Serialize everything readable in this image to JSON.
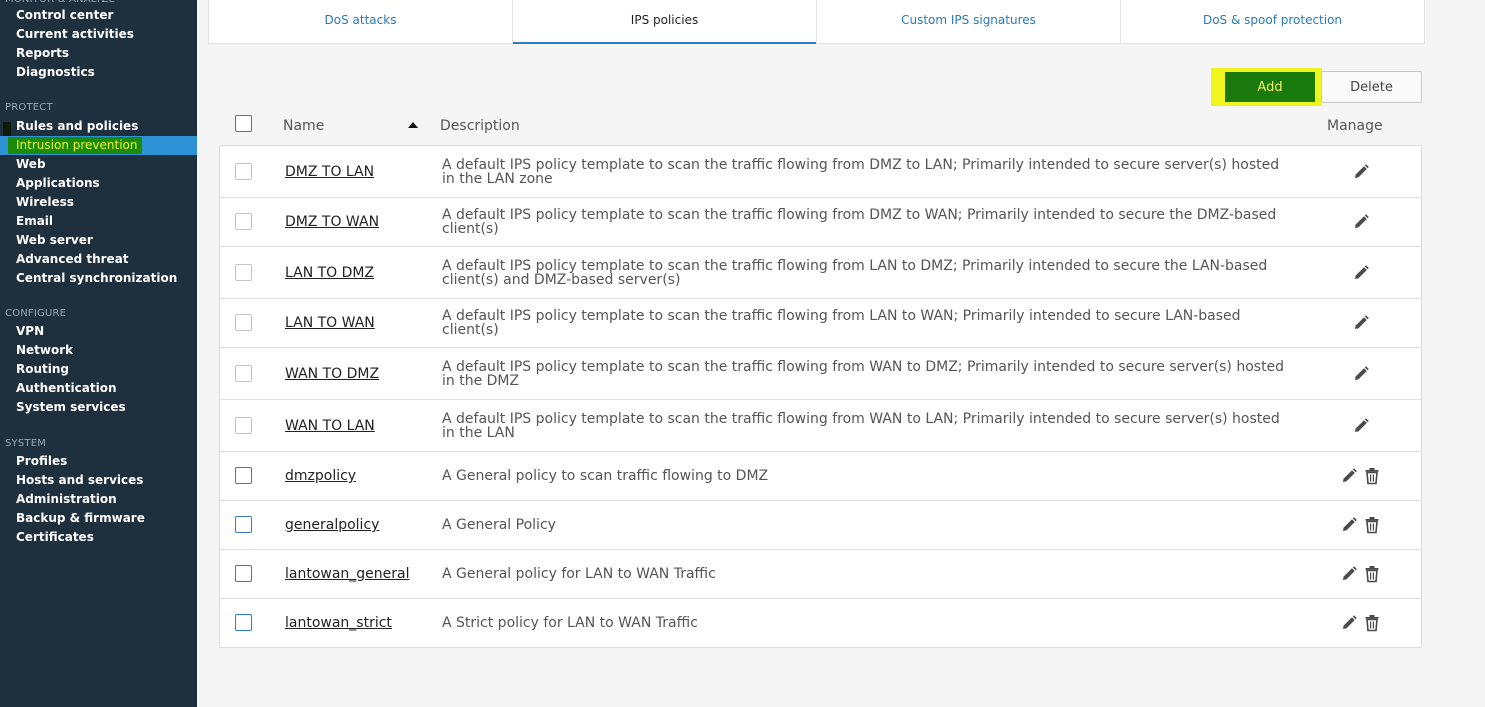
{
  "sidebar": {
    "sections": [
      {
        "header": "MONITOR & ANALYZE",
        "items": [
          "Control center",
          "Current activities",
          "Reports",
          "Diagnostics"
        ]
      },
      {
        "header": "PROTECT",
        "items": [
          "Rules and policies",
          "Intrusion prevention",
          "Web",
          "Applications",
          "Wireless",
          "Email",
          "Web server",
          "Advanced threat",
          "Central synchronization"
        ]
      },
      {
        "header": "CONFIGURE",
        "items": [
          "VPN",
          "Network",
          "Routing",
          "Authentication",
          "System services"
        ]
      },
      {
        "header": "SYSTEM",
        "items": [
          "Profiles",
          "Hosts and services",
          "Administration",
          "Backup & firmware",
          "Certificates"
        ]
      }
    ],
    "active_item": "Intrusion prevention"
  },
  "tabs": [
    {
      "label": "DoS attacks",
      "active": false
    },
    {
      "label": "IPS policies",
      "active": true
    },
    {
      "label": "Custom IPS signatures",
      "active": false
    },
    {
      "label": "DoS & spoof protection",
      "active": false
    }
  ],
  "toolbar": {
    "add_label": "Add",
    "delete_label": "Delete"
  },
  "table": {
    "columns": {
      "name": "Name",
      "description": "Description",
      "manage": "Manage"
    },
    "rows": [
      {
        "name": "DMZ TO LAN",
        "description": "A default IPS policy template to scan the traffic flowing from DMZ to LAN; Primarily intended to secure server(s) hosted in the LAN zone",
        "deletable": false
      },
      {
        "name": "DMZ TO WAN",
        "description": "A default IPS policy template to scan the traffic flowing from DMZ to WAN; Primarily intended to secure the DMZ-based client(s)",
        "deletable": false
      },
      {
        "name": "LAN TO DMZ",
        "description": "A default IPS policy template to scan the traffic flowing from LAN to DMZ; Primarily intended to secure the LAN-based client(s) and DMZ-based server(s)",
        "deletable": false
      },
      {
        "name": "LAN TO WAN",
        "description": "A default IPS policy template to scan the traffic flowing from LAN to WAN; Primarily intended to secure LAN-based client(s)",
        "deletable": false
      },
      {
        "name": "WAN TO DMZ",
        "description": "A default IPS policy template to scan the traffic flowing from WAN to DMZ; Primarily intended to secure server(s) hosted in the DMZ",
        "deletable": false
      },
      {
        "name": "WAN TO LAN",
        "description": "A default IPS policy template to scan the traffic flowing from WAN to LAN; Primarily intended to secure server(s) hosted in the LAN",
        "deletable": false
      },
      {
        "name": "dmzpolicy",
        "description": "A General policy to scan traffic flowing to DMZ",
        "deletable": true
      },
      {
        "name": "generalpolicy",
        "description": "A General Policy",
        "deletable": true
      },
      {
        "name": "lantowan_general",
        "description": "A General policy for LAN to WAN Traffic",
        "deletable": true
      },
      {
        "name": "lantowan_strict",
        "description": "A Strict policy for LAN to WAN Traffic",
        "deletable": true
      }
    ]
  },
  "icons": {
    "edit": "pencil-icon",
    "delete": "trash-icon",
    "sort": "sort-ascending-icon"
  },
  "colors": {
    "sidebar_bg": "#1e2f3d",
    "active_nav_bg": "#2e93d4",
    "highlight_yellow": "#f0f51e",
    "add_button_bg": "#1b7a0d",
    "link_blue": "#2a7ab8"
  }
}
